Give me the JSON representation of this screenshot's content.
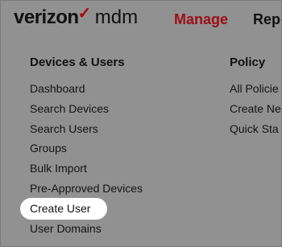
{
  "header": {
    "logo_brand": "verizon",
    "logo_check": "✓",
    "logo_product": "mdm",
    "nav": [
      {
        "label": "Manage",
        "active": true
      },
      {
        "label": "Repo"
      }
    ]
  },
  "menu": {
    "devices_users": {
      "heading": "Devices & Users",
      "items": [
        {
          "label": "Dashboard"
        },
        {
          "label": "Search Devices"
        },
        {
          "label": "Search Users"
        },
        {
          "label": "Groups"
        },
        {
          "label": "Bulk Import"
        },
        {
          "label": "Pre-Approved Devices"
        },
        {
          "label": "Create User",
          "highlighted": true
        },
        {
          "label": "User Domains"
        }
      ]
    },
    "policy": {
      "heading": "Policy",
      "items": [
        {
          "label": "All Policie"
        },
        {
          "label": "Create Ne"
        },
        {
          "label": "Quick Sta"
        }
      ]
    }
  },
  "colors": {
    "overlay": "#919191",
    "brand_red": "#9b1016",
    "text": "#141414",
    "highlight": "#ffffff"
  }
}
